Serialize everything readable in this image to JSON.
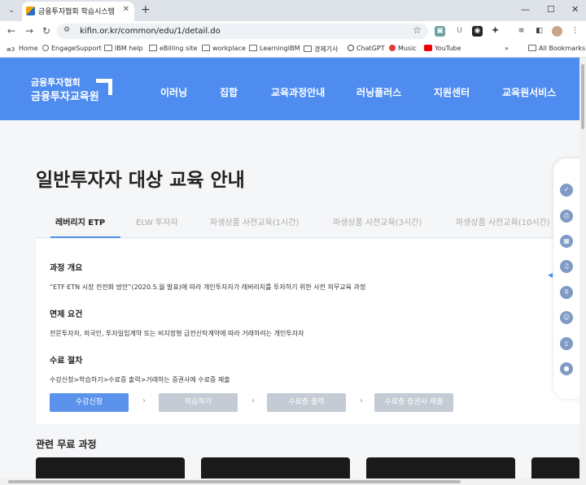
{
  "browser": {
    "tab_title": "금융투자협회 학습시스템",
    "url": "kifin.or.kr/common/edu/1/detail.do",
    "new_tab_icon": "plus-icon",
    "bookmarks": [
      "Home",
      "EngageSupport",
      "IBM help",
      "eBilling site",
      "workplace",
      "LearningIBM",
      "경제기사",
      "ChatGPT",
      "Music",
      "YouTube"
    ],
    "all_bookmarks": "All Bookmarks",
    "overflow": "»"
  },
  "site": {
    "logo_line1": "금융투자협회",
    "logo_line2": "금융투자교육원",
    "nav": [
      "이러닝",
      "집합",
      "교육과정안내",
      "러닝플러스",
      "지원센터",
      "교육원서비스"
    ]
  },
  "page_title": "일반투자자 대상 교육 안내",
  "tabs": [
    "레버리지 ETP",
    "ELW 투자자",
    "파생상품 사전교육(1시간)",
    "파생상품 사전교육(3시간)",
    "파생상품 사전교육(10시간)"
  ],
  "active_tab": 0,
  "sections": [
    {
      "heading": "과정 개요",
      "text": "“ETF·ETN 시장 전전화 방안”(2020.5.월 발표)에 따라 개인투자자가 레버리지를 투자하기 위한 사전 의무교육 과정"
    },
    {
      "heading": "면제 요건",
      "text": "전문투자자, 외국인, 투자일임계약 또는 비지정형 금전신탁계약에 따라 거래하려는 개인투자자"
    },
    {
      "heading": "수료 절차",
      "text": "수강신청>학습하기>수료증 출력>거래하는 증권사에 수료증 제출"
    }
  ],
  "steps": [
    "수강신청",
    "학습하기",
    "수료증 출력",
    "수료증 증권사 제출"
  ],
  "step_arrow": "›",
  "related_heading": "관련 무료 과정",
  "quick_menu_icons": [
    "check-icon",
    "print-icon",
    "calendar-icon",
    "headset-icon",
    "search-icon",
    "user-check-icon",
    "tablet-icon",
    "location-icon"
  ],
  "colors": {
    "brand": "#4f8cf0",
    "primary_button": "#5b93ec",
    "disabled_button": "#c5cbd4"
  }
}
